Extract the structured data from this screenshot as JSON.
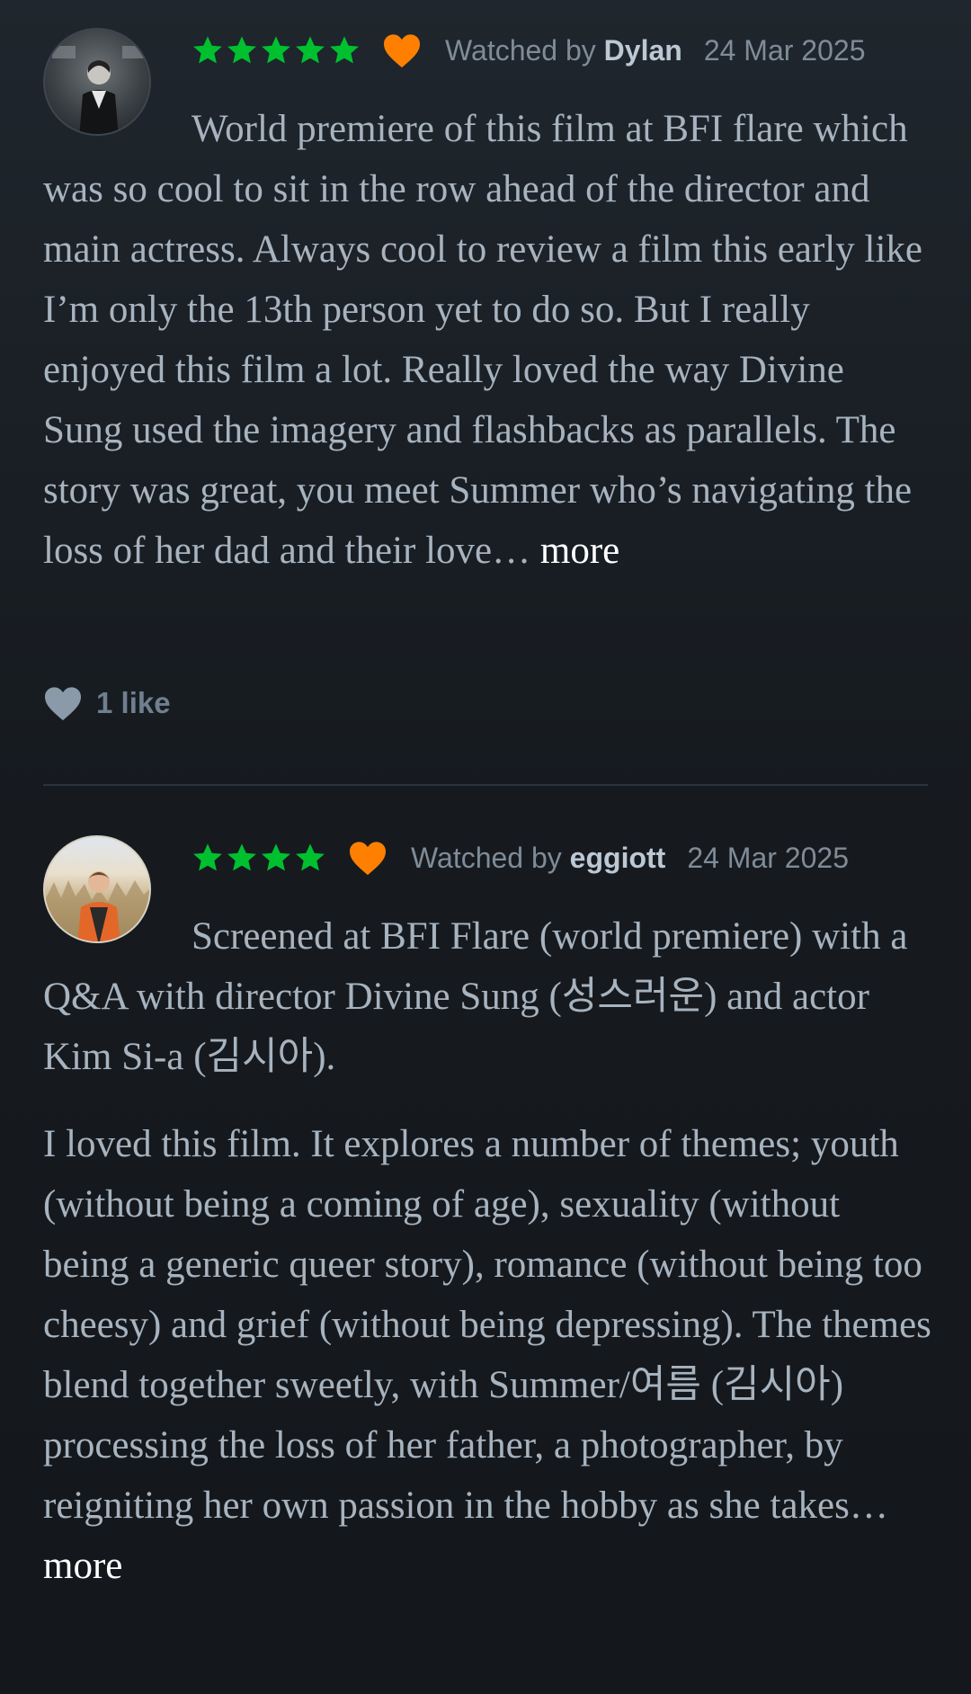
{
  "colors": {
    "star": "#00c030",
    "liked_heart": "#ff8000",
    "like_icon": "#8a9aa9",
    "more_link": "#ffffff",
    "divider": "#2b343d"
  },
  "reviews": [
    {
      "avatar_icon": "user-avatar-photo",
      "rating_stars": 5,
      "liked": true,
      "watched_prefix": "Watched by",
      "username": "Dylan",
      "date": "24 Mar 2025",
      "paragraphs": [
        "World premiere of this film at BFI flare which was so cool to sit in the row ahead of the director and main actress. Always cool to review a film this early like I’m only the 13th person yet to do so. But I really enjoyed this film a lot. Really loved the way Divine Sung used the imagery and flashbacks as parallels. The story was great, you meet Summer who’s navigating the loss of her dad and their love…"
      ],
      "more_label": "more",
      "likes_label": "1 like"
    },
    {
      "avatar_icon": "user-avatar-photo",
      "rating_stars": 4,
      "liked": true,
      "watched_prefix": "Watched by",
      "username": "eggiott",
      "date": "24 Mar 2025",
      "paragraphs": [
        "Screened at BFI Flare (world premiere) with a Q&A with director Divine Sung (성스러운) and actor Kim Si-a (김시아).",
        "I loved this film. It explores a number of themes; youth (without being a coming of age), sexuality (without being a generic queer story), romance (without being too cheesy) and grief (without being depressing). The themes blend together sweetly, with Summer/여름 (김시아) processing the loss of her father, a photographer, by reigniting her own passion in the hobby as she takes…"
      ],
      "more_label": "more"
    }
  ]
}
